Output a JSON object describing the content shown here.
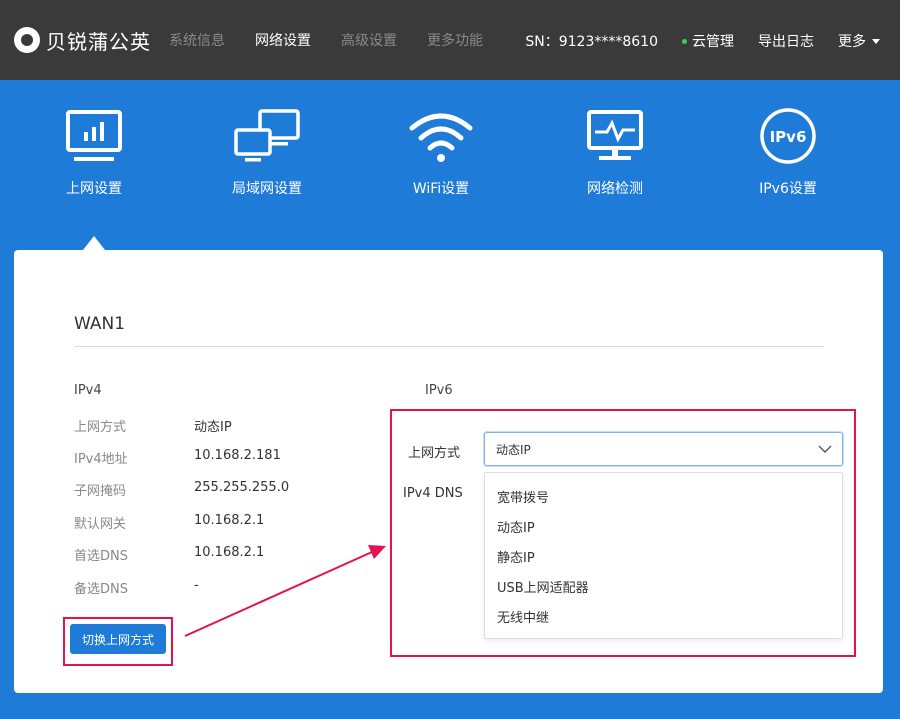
{
  "brand": {
    "name": "贝锐蒲公英"
  },
  "nav": [
    "系统信息",
    "网络设置",
    "高级设置",
    "更多功能"
  ],
  "right_nav": {
    "sn": "SN：9123****8610",
    "cloud": "云管理",
    "export_log": "导出日志",
    "more": "更多"
  },
  "icon_tabs": [
    {
      "label": "上网设置",
      "icon": "monitor-chart-icon"
    },
    {
      "label": "局域网设置",
      "icon": "lan-monitors-icon"
    },
    {
      "label": "WiFi设置",
      "icon": "wifi-icon"
    },
    {
      "label": "网络检测",
      "icon": "monitor-pulse-icon"
    },
    {
      "label": "IPv6设置",
      "icon": "ipv6-badge-icon",
      "badge": "IPv6"
    }
  ],
  "wan": {
    "title": "WAN1",
    "ipv4": {
      "heading": "IPv4",
      "rows": [
        {
          "label": "上网方式",
          "value": "动态IP"
        },
        {
          "label": "IPv4地址",
          "value": "10.168.2.181"
        },
        {
          "label": "子网掩码",
          "value": "255.255.255.0"
        },
        {
          "label": "默认网关",
          "value": "10.168.2.1"
        },
        {
          "label": "首选DNS",
          "value": "10.168.2.1"
        },
        {
          "label": "备选DNS",
          "value": "-"
        }
      ],
      "switch_button": "切换上网方式"
    },
    "ipv6": {
      "heading": "IPv6",
      "mode_label": "上网方式",
      "dns_label": "IPv4 DNS",
      "selected": "动态IP",
      "options": [
        "宽带拨号",
        "动态IP",
        "静态IP",
        "USB上网适配器",
        "无线中继"
      ]
    }
  },
  "colors": {
    "accent": "#1e7bd8",
    "topbar": "#3a3a3a",
    "highlight": "#e2134f",
    "status_online": "#39d15c"
  }
}
